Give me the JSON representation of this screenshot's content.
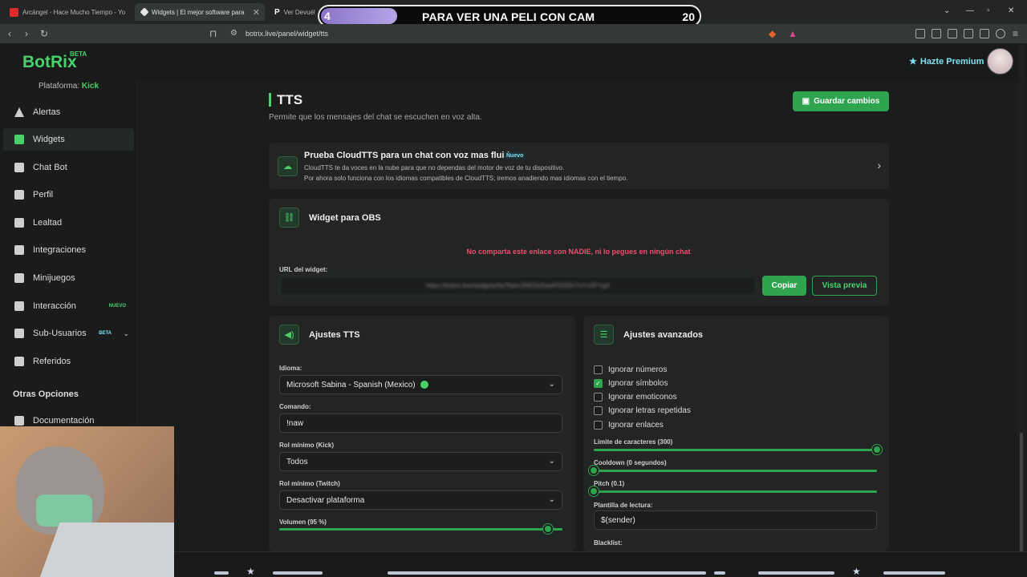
{
  "browser": {
    "tabs": [
      {
        "label": "Arcángel - Hace Mucho Tiempo - Yo",
        "favicon_color": "#e02b2b"
      },
      {
        "label": "Widgets | El mejor software para",
        "favicon_color": "#e6e6e6"
      },
      {
        "label": "Ver Devuél",
        "favicon_color": "#232624"
      }
    ],
    "url": "botrix.live/panel/widget/tts"
  },
  "overlay": {
    "left_value": "4",
    "title": "PARA VER UNA PELI CON CAM",
    "right_value": "20",
    "progress_fraction": 0.2
  },
  "header": {
    "logo": "BotRix",
    "logo_badge": "BETA",
    "premium_label": "Hazte Premium"
  },
  "sidebar": {
    "platform_label": "Plataforma:",
    "platform_value": "Kick",
    "items": [
      {
        "label": "Alertas",
        "icon": "warning-icon"
      },
      {
        "label": "Widgets",
        "icon": "grid-icon"
      },
      {
        "label": "Chat Bot",
        "icon": "robot-icon"
      },
      {
        "label": "Perfil",
        "icon": "id-card-icon"
      },
      {
        "label": "Lealtad",
        "icon": "trophy-icon"
      },
      {
        "label": "Integraciones",
        "icon": "plug-icon"
      },
      {
        "label": "Minijuegos",
        "icon": "gamepad-icon"
      },
      {
        "label": "Interacción",
        "icon": "music-icon",
        "badge": "NUEVO"
      },
      {
        "label": "Sub-Usuarios",
        "icon": "users-icon",
        "badge": "BETA"
      },
      {
        "label": "Referidos",
        "icon": "referral-icon"
      }
    ],
    "section_title": "Otras Opciones",
    "doc_item": "Documentación"
  },
  "page": {
    "title": "TTS",
    "subtitle": "Permite que los mensajes del chat se escuchen en voz alta.",
    "save_label": "Guardar cambios"
  },
  "promo": {
    "title": "Prueba CloudTTS para un chat con voz mas fluido",
    "badge": "Nuevo",
    "line1": "CloudTTS te da voces en la nube para que no dependas del motor de voz de tu dispositivo.",
    "line2": "Por ahora solo funciona con los idiomas compatibles de CloudTTS; iremos anadiendo mas idiomas con el tiempo."
  },
  "obs": {
    "title": "Widget para OBS",
    "warning": "No comparta este enlace con NADIE, ni lo pegues en ningún chat",
    "url_label": "URL del widget:",
    "url_value": "https://botrix.live/widgets/tts?bid=ZfW2lsSweRS0S5rTnYs2FYgA",
    "copy_label": "Copiar",
    "preview_label": "Vista previa"
  },
  "tts": {
    "title": "Ajustes TTS",
    "language_label": "Idioma:",
    "language_value": "Microsoft Sabina - Spanish (Mexico)",
    "command_label": "Comando:",
    "command_value": "!naw",
    "role_kick_label": "Rol mínimo (Kick)",
    "role_kick_value": "Todos",
    "role_twitch_label": "Rol mínimo (Twitch)",
    "role_twitch_value": "Desactivar plataforma",
    "volume_label": "Volumen (95 %)",
    "volume_fraction": 0.95
  },
  "advanced": {
    "title": "Ajustes avanzados",
    "options": [
      {
        "label": "Ignorar números",
        "checked": false
      },
      {
        "label": "Ignorar símbolos",
        "checked": true
      },
      {
        "label": "Ignorar emoticonos",
        "checked": false
      },
      {
        "label": "Ignorar letras repetidas",
        "checked": false
      },
      {
        "label": "Ignorar enlaces",
        "checked": false
      }
    ],
    "char_limit_label": "Límite de caracteres (300)",
    "char_limit_fraction": 1.0,
    "cooldown_label": "Cooldown (0 segundos)",
    "cooldown_fraction": 0.0,
    "pitch_label": "Pitch (0.1)",
    "pitch_fraction": 0.0,
    "template_label": "Plantilla de lectura:",
    "template_value": "$(sender)",
    "blacklist_label": "Blacklist:"
  },
  "colors": {
    "accent": "#49d26a",
    "button": "#2ea44f",
    "warning": "#f04d6e",
    "premium": "#7ee0f0"
  }
}
